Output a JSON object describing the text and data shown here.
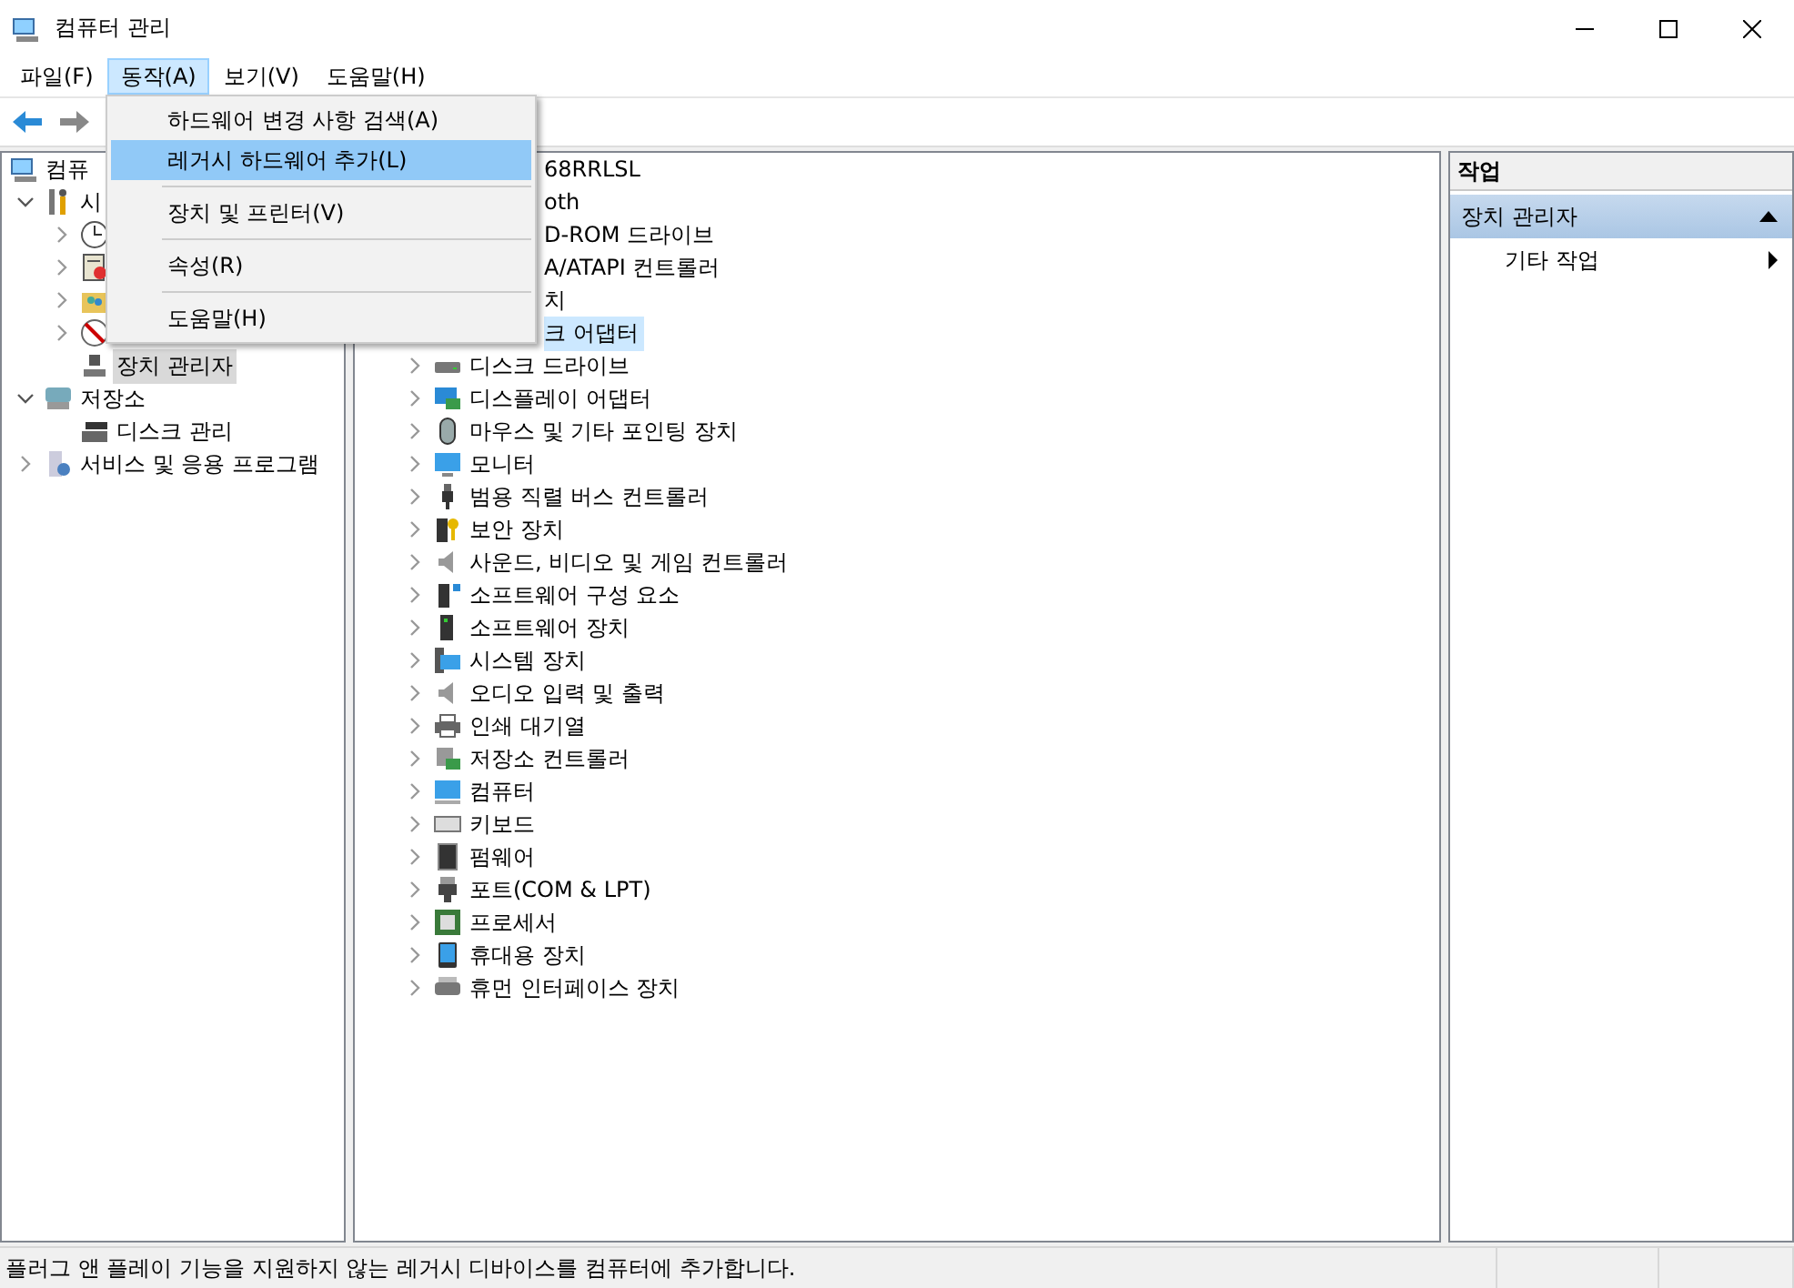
{
  "window": {
    "title": "컴퓨터 관리"
  },
  "menu_bar": [
    {
      "label": "파일(F)",
      "selected": false
    },
    {
      "label": "동작(A)",
      "selected": true
    },
    {
      "label": "보기(V)",
      "selected": false
    },
    {
      "label": "도움말(H)",
      "selected": false
    }
  ],
  "dropdown_menu": [
    {
      "kind": "item",
      "label": "하드웨어 변경 사항 검색(A)",
      "selected": false
    },
    {
      "kind": "item",
      "label": "레거시 하드웨어 추가(L)",
      "selected": true
    },
    {
      "kind": "separator"
    },
    {
      "kind": "item",
      "label": "장치 및 프린터(V)",
      "selected": false
    },
    {
      "kind": "separator"
    },
    {
      "kind": "item",
      "label": "속성(R)",
      "selected": false
    },
    {
      "kind": "separator"
    },
    {
      "kind": "item",
      "label": "도움말(H)",
      "selected": false
    }
  ],
  "tree": [
    {
      "label": "컴퓨",
      "selected": false,
      "children": [
        {
          "label": "시",
          "expanded": true,
          "selected": false,
          "children": [
            {
              "expanded": false
            },
            {
              "expanded": false
            },
            {
              "expanded": false
            },
            {
              "expanded": false
            },
            {
              "label": "장치 관리자",
              "selected": true
            }
          ]
        },
        {
          "label": "저장소",
          "expanded": true,
          "selected": false,
          "children": [
            {
              "label": "디스크 관리",
              "selected": false
            }
          ]
        },
        {
          "label": "서비스 및 응용 프로그램",
          "expanded": false,
          "selected": false
        }
      ]
    }
  ],
  "devices": [
    {
      "label": "68RRLSL",
      "partial": true,
      "selected": false
    },
    {
      "label": "oth",
      "partial": true,
      "selected": false
    },
    {
      "label": "D-ROM 드라이브",
      "partial": true,
      "selected": false
    },
    {
      "label": "A/ATAPI 컨트롤러",
      "partial": true,
      "selected": false
    },
    {
      "label": "치",
      "partial": true,
      "selected": false
    },
    {
      "label": "크 어댑터",
      "partial": true,
      "selected": true
    },
    {
      "label": "디스크 드라이브",
      "partial": false,
      "selected": false
    },
    {
      "label": "디스플레이 어댑터",
      "partial": false,
      "selected": false
    },
    {
      "label": "마우스 및 기타 포인팅 장치",
      "partial": false,
      "selected": false
    },
    {
      "label": "모니터",
      "partial": false,
      "selected": false
    },
    {
      "label": "범용 직렬 버스 컨트롤러",
      "partial": false,
      "selected": false
    },
    {
      "label": "보안 장치",
      "partial": false,
      "selected": false
    },
    {
      "label": "사운드, 비디오 및 게임 컨트롤러",
      "partial": false,
      "selected": false
    },
    {
      "label": "소프트웨어 구성 요소",
      "partial": false,
      "selected": false
    },
    {
      "label": "소프트웨어 장치",
      "partial": false,
      "selected": false
    },
    {
      "label": "시스템 장치",
      "partial": false,
      "selected": false
    },
    {
      "label": "오디오 입력 및 출력",
      "partial": false,
      "selected": false
    },
    {
      "label": "인쇄 대기열",
      "partial": false,
      "selected": false
    },
    {
      "label": "저장소 컨트롤러",
      "partial": false,
      "selected": false
    },
    {
      "label": "컴퓨터",
      "partial": false,
      "selected": false
    },
    {
      "label": "키보드",
      "partial": false,
      "selected": false
    },
    {
      "label": "펌웨어",
      "partial": false,
      "selected": false
    },
    {
      "label": "포트(COM & LPT)",
      "partial": false,
      "selected": false
    },
    {
      "label": "프로세서",
      "partial": false,
      "selected": false
    },
    {
      "label": "휴대용 장치",
      "partial": false,
      "selected": false
    },
    {
      "label": "휴먼 인터페이스 장치",
      "partial": false,
      "selected": false
    }
  ],
  "actions": {
    "header": "작업",
    "section": {
      "label": "장치 관리자",
      "expanded": true
    },
    "items": [
      {
        "label": "기타 작업"
      }
    ]
  },
  "status_bar": {
    "text": "플러그 앤 플레이 기능을 지원하지 않는 레거시 디바이스를 컴퓨터에 추가합니다."
  }
}
